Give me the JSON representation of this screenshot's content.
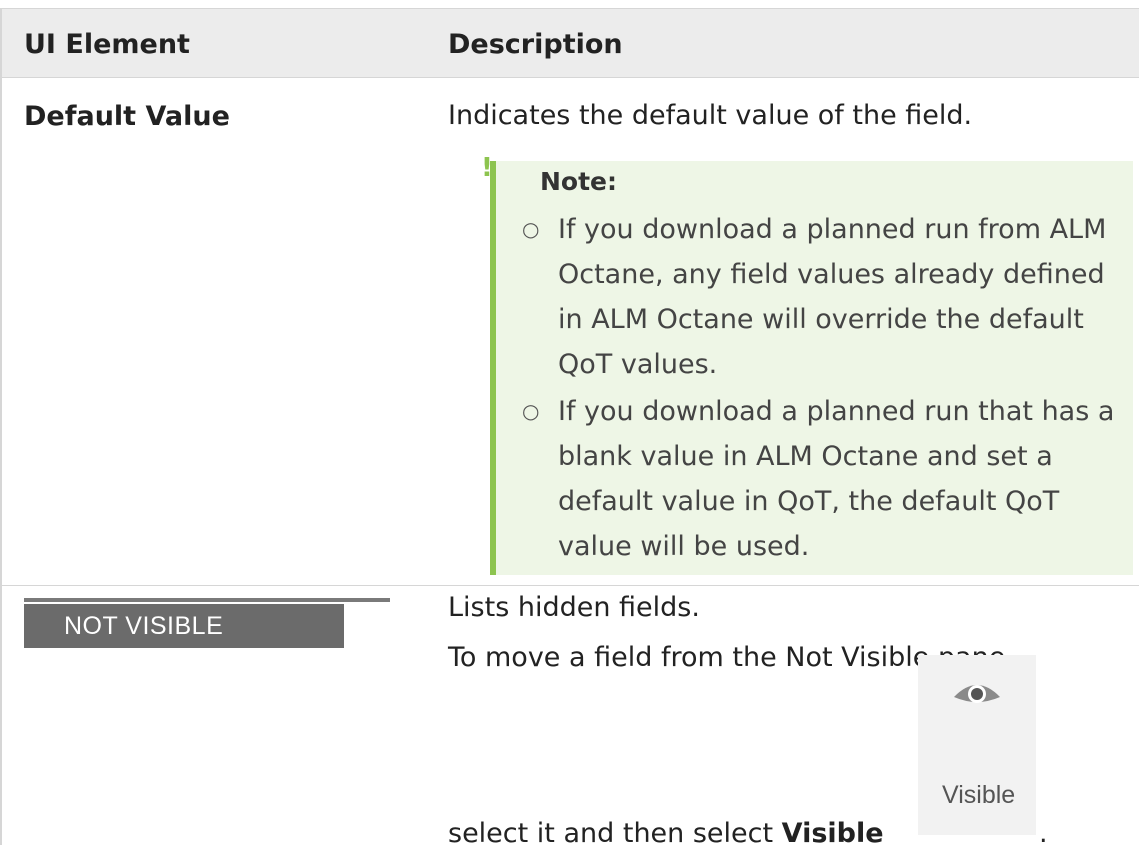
{
  "table": {
    "headers": [
      "UI Element",
      "Description"
    ],
    "rows": [
      {
        "term": "Default Value",
        "description": "Indicates the default value of the field.",
        "note": {
          "title": "Note:",
          "items": [
            "If you download a planned run from ALM Octane, any field values already defined in ALM Octane will override the default QoT values.",
            "If you download a planned run that has a blank value in ALM Octane and set a default value in QoT, the default QoT value will be used."
          ]
        }
      },
      {
        "term_image_label": "NOT VISIBLE",
        "description_line1": "Lists hidden fields.",
        "description_line2": "To move a field from the Not Visible pane,",
        "description_line3_prefix": "select it and then select ",
        "description_line3_bold": "Visible",
        "description_line3_suffix": ".",
        "button": {
          "label": "Visible",
          "icon": "eye-icon"
        }
      }
    ]
  },
  "colors": {
    "header_bg": "#ececec",
    "note_bg": "#eef6e6",
    "note_accent": "#8dc44f",
    "tab_bg": "#6b6b6b"
  }
}
